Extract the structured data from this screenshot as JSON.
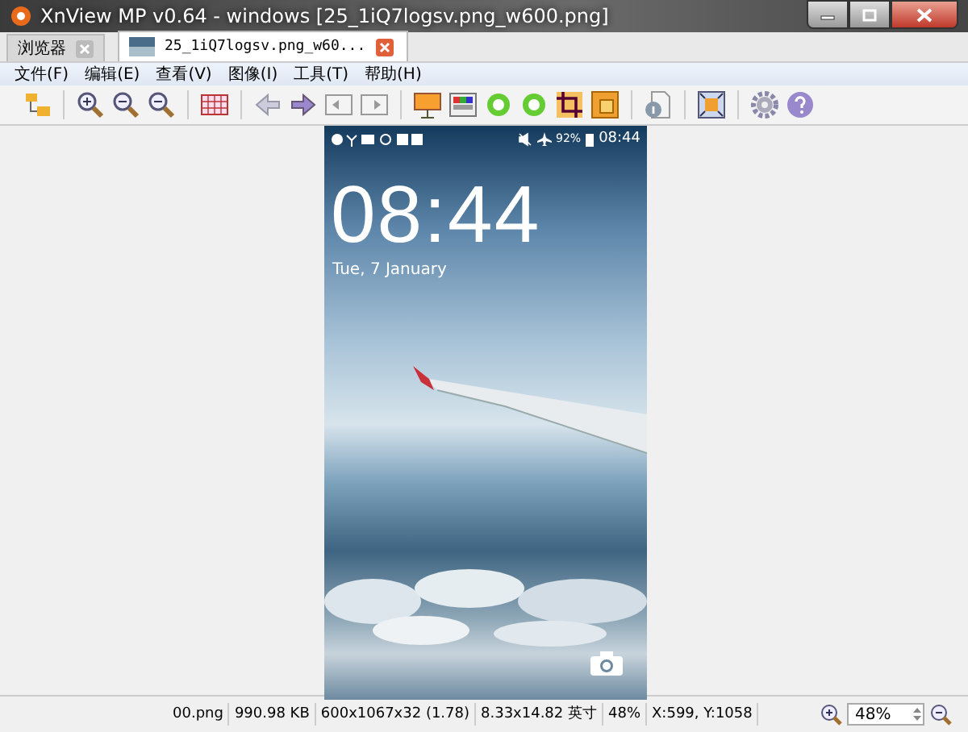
{
  "window": {
    "title": "XnView MP v0.64 - windows [25_1iQ7logsv.png_w600.png]"
  },
  "tabs": [
    {
      "label": "浏览器",
      "selected": false
    },
    {
      "label": "25_1iQ7logsv.png_w60...",
      "selected": true
    }
  ],
  "menu": [
    "文件(F)",
    "编辑(E)",
    "查看(V)",
    "图像(I)",
    "工具(T)",
    "帮助(H)"
  ],
  "image": {
    "status_battery": "92%",
    "status_time": "08:44",
    "clock": "08:44",
    "date": "Tue, 7 January"
  },
  "status_bar": [
    "00.png",
    "990.98 KB",
    "600x1067x32 (1.78)",
    "8.33x14.82 英寸",
    "48%",
    "X:599, Y:1058"
  ],
  "zoom": {
    "value": "48%"
  }
}
